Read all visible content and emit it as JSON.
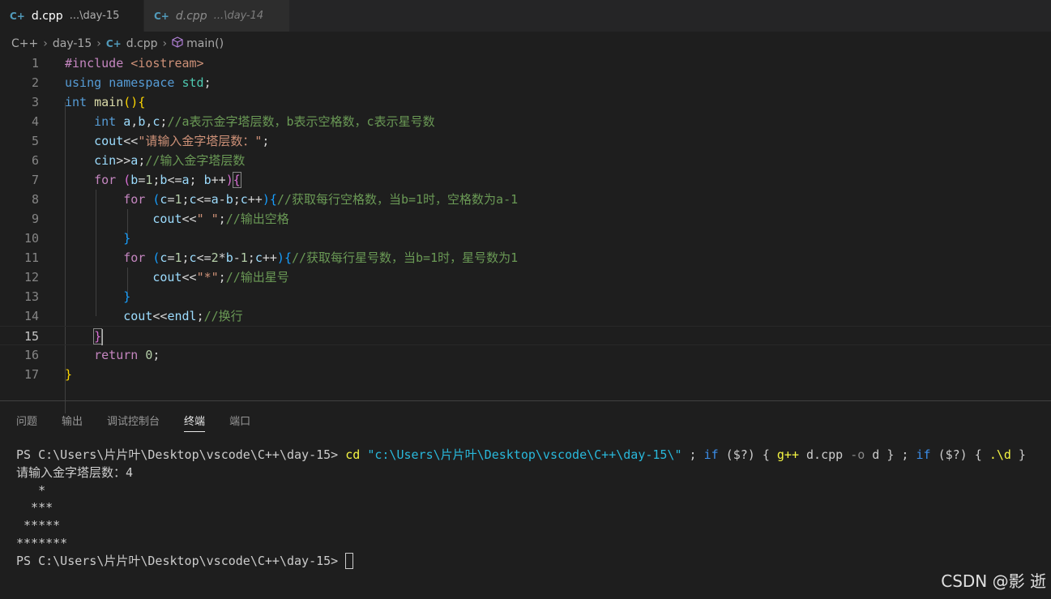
{
  "tabs": [
    {
      "icon": "cpp-file-icon",
      "name": "d.cpp",
      "path": "...\\day-15",
      "active": true
    },
    {
      "icon": "cpp-file-icon",
      "name": "d.cpp",
      "path": "...\\day-14",
      "active": false
    }
  ],
  "breadcrumb": [
    "C++",
    "day-15",
    "d.cpp",
    "main()"
  ],
  "code_lines": [
    {
      "n": "1",
      "text": "#include <iostream>"
    },
    {
      "n": "2",
      "text": "using namespace std;"
    },
    {
      "n": "3",
      "text": "int main(){"
    },
    {
      "n": "4",
      "text": "    int a,b,c;//a表示金字塔层数，b表示空格数，c表示星号数"
    },
    {
      "n": "5",
      "text": "    cout<<\"请输入金字塔层数：\";"
    },
    {
      "n": "6",
      "text": "    cin>>a;//输入金字塔层数"
    },
    {
      "n": "7",
      "text": "    for (b=1;b<=a; b++){"
    },
    {
      "n": "8",
      "text": "        for (c=1;c<=a-b;c++){//获取每行空格数，当b=1时，空格数为a-1"
    },
    {
      "n": "9",
      "text": "            cout<<\" \";//输出空格"
    },
    {
      "n": "10",
      "text": "        }"
    },
    {
      "n": "11",
      "text": "        for (c=1;c<=2*b-1;c++){//获取每行星号数，当b=1时，星号数为1"
    },
    {
      "n": "12",
      "text": "            cout<<\"*\";//输出星号"
    },
    {
      "n": "13",
      "text": "        }"
    },
    {
      "n": "14",
      "text": "        cout<<endl;//换行"
    },
    {
      "n": "15",
      "text": "    }"
    },
    {
      "n": "16",
      "text": "    return 0;"
    },
    {
      "n": "17",
      "text": "}"
    }
  ],
  "current_line": "15",
  "panel_tabs": [
    "问题",
    "输出",
    "调试控制台",
    "终端",
    "端口"
  ],
  "active_panel_tab": "终端",
  "terminal": {
    "prompt": "PS C:\\Users\\片片叶\\Desktop\\vscode\\C++\\day-15>",
    "command": "cd \"c:\\Users\\片片叶\\Desktop\\vscode\\C++\\day-15\\\" ; if ($?) { g++ d.cpp -o d } ; if ($?) { .\\d }",
    "output": [
      "请输入金字塔层数：4",
      "   *",
      "  ***",
      " *****",
      "*******"
    ],
    "prompt2": "PS C:\\Users\\片片叶\\Desktop\\vscode\\C++\\day-15>"
  },
  "watermark": "CSDN @影 逝"
}
